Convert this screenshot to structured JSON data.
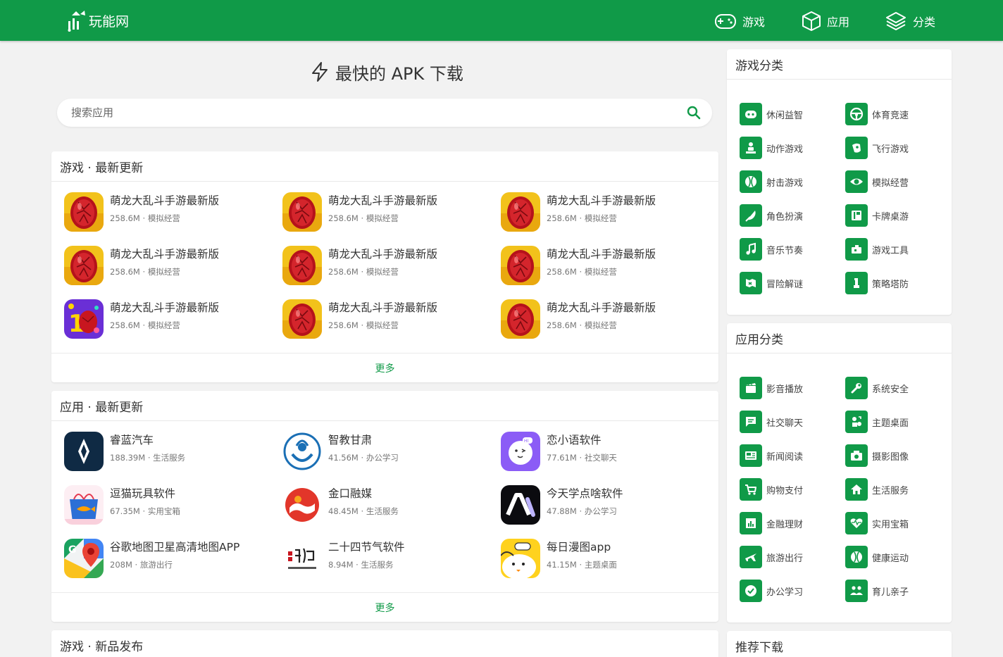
{
  "brand": {
    "name": "玩能网",
    "color": "#109a48"
  },
  "nav": [
    {
      "label": "游戏",
      "icon": "gamepad-icon"
    },
    {
      "label": "应用",
      "icon": "cube-icon"
    },
    {
      "label": "分类",
      "icon": "layers-icon"
    }
  ],
  "hero": {
    "title": "最快的 APK 下载",
    "icon": "lightning-icon"
  },
  "search": {
    "placeholder": "搜索应用",
    "icon": "search-icon"
  },
  "games_latest": {
    "title": "游戏 · 最新更新",
    "more": "更多",
    "items": [
      {
        "name": "萌龙大乱斗手游最新版",
        "size": "258.6M",
        "category": "模拟经营",
        "icon": "dragon-egg-icon"
      },
      {
        "name": "萌龙大乱斗手游最新版",
        "size": "258.6M",
        "category": "模拟经营",
        "icon": "dragon-egg-icon"
      },
      {
        "name": "萌龙大乱斗手游最新版",
        "size": "258.6M",
        "category": "模拟经营",
        "icon": "dragon-egg-icon"
      },
      {
        "name": "萌龙大乱斗手游最新版",
        "size": "258.6M",
        "category": "模拟经营",
        "icon": "dragon-egg-icon"
      },
      {
        "name": "萌龙大乱斗手游最新版",
        "size": "258.6M",
        "category": "模拟经营",
        "icon": "dragon-egg-icon"
      },
      {
        "name": "萌龙大乱斗手游最新版",
        "size": "258.6M",
        "category": "模拟经营",
        "icon": "dragon-egg-icon"
      },
      {
        "name": "萌龙大乱斗手游最新版",
        "size": "258.6M",
        "category": "模拟经营",
        "icon": "anniversary-icon"
      },
      {
        "name": "萌龙大乱斗手游最新版",
        "size": "258.6M",
        "category": "模拟经营",
        "icon": "dragon-egg-icon"
      },
      {
        "name": "萌龙大乱斗手游最新版",
        "size": "258.6M",
        "category": "模拟经营",
        "icon": "dragon-egg-icon"
      }
    ]
  },
  "apps_latest": {
    "title": "应用 · 最新更新",
    "more": "更多",
    "items": [
      {
        "name": "睿蓝汽车",
        "size": "188.39M",
        "category": "生活服务",
        "icon": "ruilan-car-icon"
      },
      {
        "name": "智教甘肃",
        "size": "41.56M",
        "category": "办公学习",
        "icon": "zhijiao-gansu-icon"
      },
      {
        "name": "恋小语软件",
        "size": "77.61M",
        "category": "社交聊天",
        "icon": "lianxiaoyu-icon"
      },
      {
        "name": "逗猫玩具软件",
        "size": "67.35M",
        "category": "实用宝箱",
        "icon": "cat-toy-icon"
      },
      {
        "name": "金口融媒",
        "size": "48.45M",
        "category": "生活服务",
        "icon": "jinkou-media-icon"
      },
      {
        "name": "今天学点啥软件",
        "size": "47.88M",
        "category": "办公学习",
        "icon": "ai-learn-icon"
      },
      {
        "name": "谷歌地图卫星高清地图APP",
        "size": "208M",
        "category": "旅游出行",
        "icon": "google-maps-icon"
      },
      {
        "name": "二十四节气软件",
        "size": "8.94M",
        "category": "生活服务",
        "icon": "solar-terms-icon"
      },
      {
        "name": "每日漫图app",
        "size": "41.15M",
        "category": "主题桌面",
        "icon": "daily-comic-icon"
      }
    ]
  },
  "games_new": {
    "title": "游戏 · 新品发布"
  },
  "game_categories": {
    "title": "游戏分类",
    "items": [
      {
        "label": "休闲益智",
        "icon": "gamepad-icon"
      },
      {
        "label": "体育竞速",
        "icon": "steering-wheel-icon"
      },
      {
        "label": "动作游戏",
        "icon": "fighter-icon"
      },
      {
        "label": "飞行游戏",
        "icon": "plane-icon"
      },
      {
        "label": "射击游戏",
        "icon": "ball-icon"
      },
      {
        "label": "模拟经营",
        "icon": "eye-icon"
      },
      {
        "label": "角色扮演",
        "icon": "sword-icon"
      },
      {
        "label": "卡牌桌游",
        "icon": "card-icon"
      },
      {
        "label": "音乐节奏",
        "icon": "music-note-icon"
      },
      {
        "label": "游戏工具",
        "icon": "tool-icon"
      },
      {
        "label": "冒险解谜",
        "icon": "map-icon"
      },
      {
        "label": "策略塔防",
        "icon": "tower-icon"
      }
    ]
  },
  "app_categories": {
    "title": "应用分类",
    "items": [
      {
        "label": "影音播放",
        "icon": "clapper-icon"
      },
      {
        "label": "系统安全",
        "icon": "wrench-icon"
      },
      {
        "label": "社交聊天",
        "icon": "chat-icon"
      },
      {
        "label": "主题桌面",
        "icon": "theme-icon"
      },
      {
        "label": "新闻阅读",
        "icon": "news-icon"
      },
      {
        "label": "摄影图像",
        "icon": "camera-icon"
      },
      {
        "label": "购物支付",
        "icon": "cart-icon"
      },
      {
        "label": "生活服务",
        "icon": "home-icon"
      },
      {
        "label": "金融理财",
        "icon": "chart-icon"
      },
      {
        "label": "实用宝箱",
        "icon": "heart-pulse-icon"
      },
      {
        "label": "旅游出行",
        "icon": "flight-icon"
      },
      {
        "label": "健康运动",
        "icon": "sport-icon"
      },
      {
        "label": "办公学习",
        "icon": "check-icon"
      },
      {
        "label": "育儿亲子",
        "icon": "family-icon"
      }
    ]
  },
  "recommend": {
    "title": "推荐下载"
  }
}
